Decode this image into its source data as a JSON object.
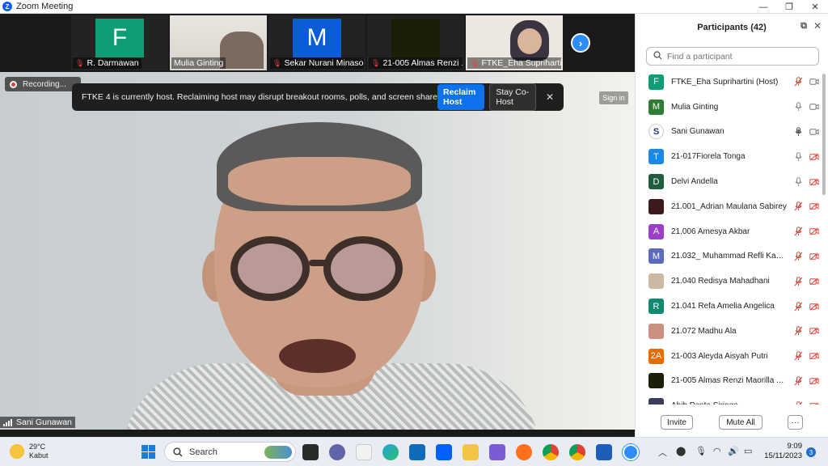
{
  "window": {
    "title": "Zoom Meeting",
    "minimize": "—",
    "maximize": "❐",
    "close": "✕"
  },
  "strip": {
    "tiles": [
      {
        "name": "R. Darmawan",
        "initial": "F",
        "color": "#0f9d76"
      },
      {
        "name": "Mulia Ginting",
        "initial": "",
        "color": "#d8d6d0"
      },
      {
        "name": "Sekar Nurani Minaso...",
        "initial": "M",
        "color": "#0b5cd6"
      },
      {
        "name": "21-005 Almas Renzi ...",
        "initial": "",
        "color": "#1d1e08"
      },
      {
        "name": "FTKE_Eha Suprihartini",
        "initial": "",
        "color": "#e9e4de"
      }
    ],
    "next_arrow": "›"
  },
  "video": {
    "recording_label": "Recording...",
    "banner_message": "FTKE 4 is currently host. Reclaiming host may disrupt breakout rooms, polls, and screen share",
    "reclaim_label": "Reclaim Host",
    "stay_label": "Stay Co-Host",
    "banner_close": "✕",
    "signin_label": "Sign in",
    "speaker_name": "Sani Gunawan"
  },
  "participants": {
    "title": "Participants (42)",
    "search_placeholder": "Find a participant",
    "items": [
      {
        "name": "FTKE_Eha Suprihartini (Host)",
        "initial": "F",
        "color": "#0f9d76",
        "mic": "off",
        "video": "on"
      },
      {
        "name": "Mulia Ginting",
        "initial": "M",
        "color": "#2f7d32",
        "mic": "on",
        "video": "on"
      },
      {
        "name": "Sani Gunawan",
        "initial": "S",
        "color": "#ffffff",
        "mic": "active",
        "video": "on"
      },
      {
        "name": "21-017Fiorela Tonga",
        "initial": "T",
        "color": "#1e88e5",
        "mic": "on",
        "video": "off"
      },
      {
        "name": "Delvi Andella",
        "initial": "D",
        "color": "#1f5e3c",
        "mic": "on",
        "video": "off"
      },
      {
        "name": "21.001_Adrian Maulana Sabirey",
        "initial": "",
        "color": "#3a1a1a",
        "mic": "off",
        "video": "off"
      },
      {
        "name": "21.006 Amesya Akbar",
        "initial": "A",
        "color": "#9c3fc8",
        "mic": "off",
        "video": "off"
      },
      {
        "name": "21.032_ Muhammad Refli Kash...",
        "initial": "M",
        "color": "#5c6bc0",
        "mic": "off",
        "video": "off"
      },
      {
        "name": "21.040 Redisya Mahadhani",
        "initial": "",
        "color": "#cbb8a5",
        "mic": "off",
        "video": "off"
      },
      {
        "name": "21.041 Refa Amelia Angelica",
        "initial": "R",
        "color": "#0f8a6e",
        "mic": "off",
        "video": "off"
      },
      {
        "name": "21.072 Madhu Ala",
        "initial": "",
        "color": "#c98f7f",
        "mic": "off",
        "video": "off"
      },
      {
        "name": "21-003 Aleyda Aisyah Putri",
        "initial": "2A",
        "color": "#e66b00",
        "mic": "off",
        "video": "off"
      },
      {
        "name": "21-005 Almas Renzi Maorilla A...",
        "initial": "",
        "color": "#1d1e08",
        "mic": "off",
        "video": "off"
      },
      {
        "name": "Abib Penta Siringo...",
        "initial": "",
        "color": "#3b3b5c",
        "mic": "off",
        "video": "off"
      }
    ],
    "invite_label": "Invite",
    "mute_all_label": "Mute All",
    "more_label": "···"
  },
  "taskbar": {
    "temperature": "29°C",
    "condition": "Kabut",
    "search_label": "Search",
    "time": "9:09",
    "date": "15/11/2023",
    "notifications": "3"
  }
}
